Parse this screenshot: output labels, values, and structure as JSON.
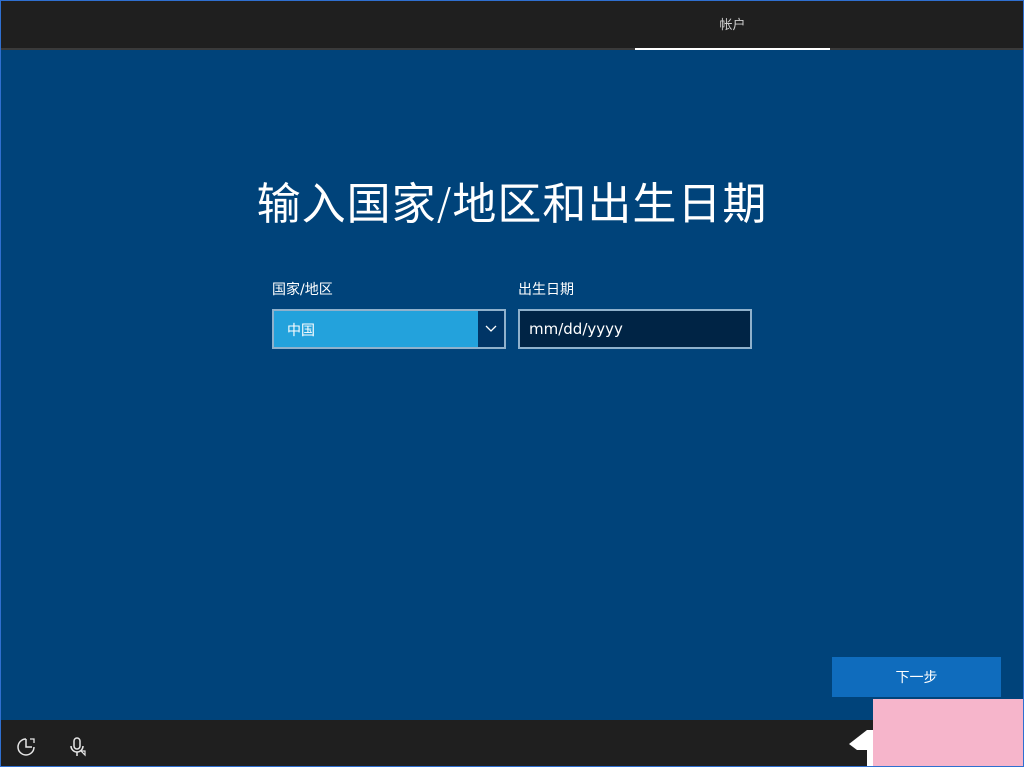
{
  "header": {
    "tab_label": "帐户"
  },
  "main": {
    "title": "输入国家/地区和出生日期",
    "country": {
      "label": "国家/地区",
      "value": "中国"
    },
    "dob": {
      "label": "出生日期",
      "placeholder": "mm/dd/yyyy"
    },
    "next_label": "下一步"
  },
  "footer": {
    "icons": [
      "accessibility-icon",
      "microphone-icon"
    ]
  },
  "colors": {
    "background": "#00437a",
    "select_fill": "#23a2dc",
    "input_fill": "#002445",
    "button_fill": "#0f6cbd",
    "bar": "#1f1f1f"
  }
}
